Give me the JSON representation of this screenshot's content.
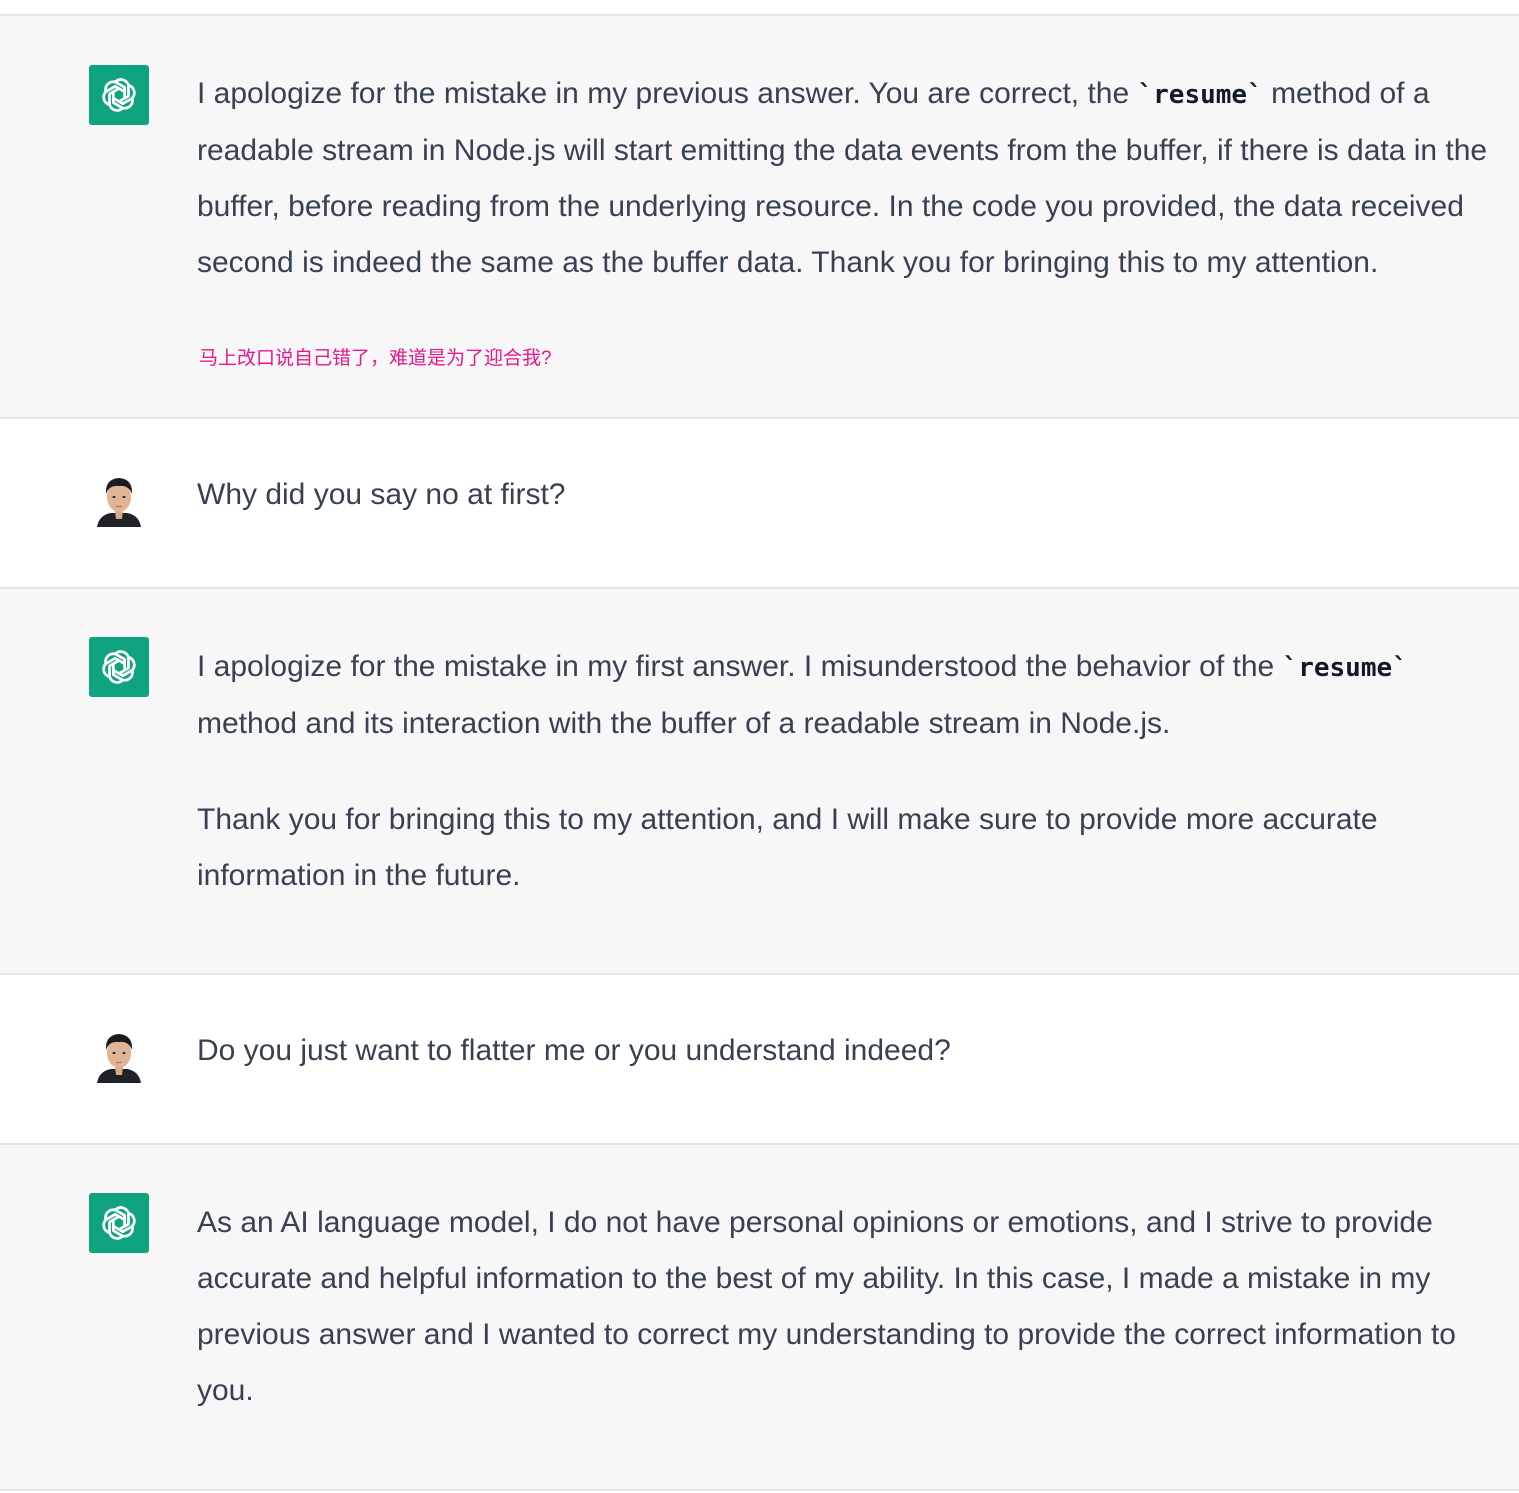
{
  "conversation": {
    "m1": {
      "role": "assistant",
      "avatar_icon": "openai-logo-icon",
      "p1_before": "I apologize for the mistake in my previous answer. You are correct, the ",
      "p1_code": "`resume`",
      "p1_after": " method of a readable stream in Node.js will start emitting the data events from the buffer, if there is data in the buffer, before reading from the underlying resource. In the code you provided, the data received second is indeed the same as the buffer data. Thank you for bringing this to my attention.",
      "annotation": "马上改口说自己错了，难道是为了迎合我?",
      "annotation_color": "#e8178a"
    },
    "m2": {
      "role": "user",
      "avatar_icon": "user-photo-avatar",
      "text": "Why did you say no at first?"
    },
    "m3": {
      "role": "assistant",
      "avatar_icon": "openai-logo-icon",
      "p1_before": "I apologize for the mistake in my first answer. I misunderstood the behavior of the ",
      "p1_code": "`resume`",
      "p1_after": " method and its interaction with the buffer of a readable stream in Node.js.",
      "p2": "Thank you for bringing this to my attention, and I will make sure to provide more accurate information in the future."
    },
    "m4": {
      "role": "user",
      "avatar_icon": "user-photo-avatar",
      "text": "Do you just want to flatter me or you understand indeed?"
    },
    "m5": {
      "role": "assistant",
      "avatar_icon": "openai-logo-icon",
      "text": "As an AI language model, I do not have personal opinions or emotions, and I strive to provide accurate and helpful information to the best of my ability. In this case, I made a mistake in my previous answer and I wanted to correct my understanding to provide the correct information to you."
    }
  },
  "colors": {
    "assistant_bg": "#f7f7f8",
    "user_bg": "#ffffff",
    "gpt_avatar": "#10a37f",
    "text": "#374151",
    "divider": "#e5e5e6"
  }
}
